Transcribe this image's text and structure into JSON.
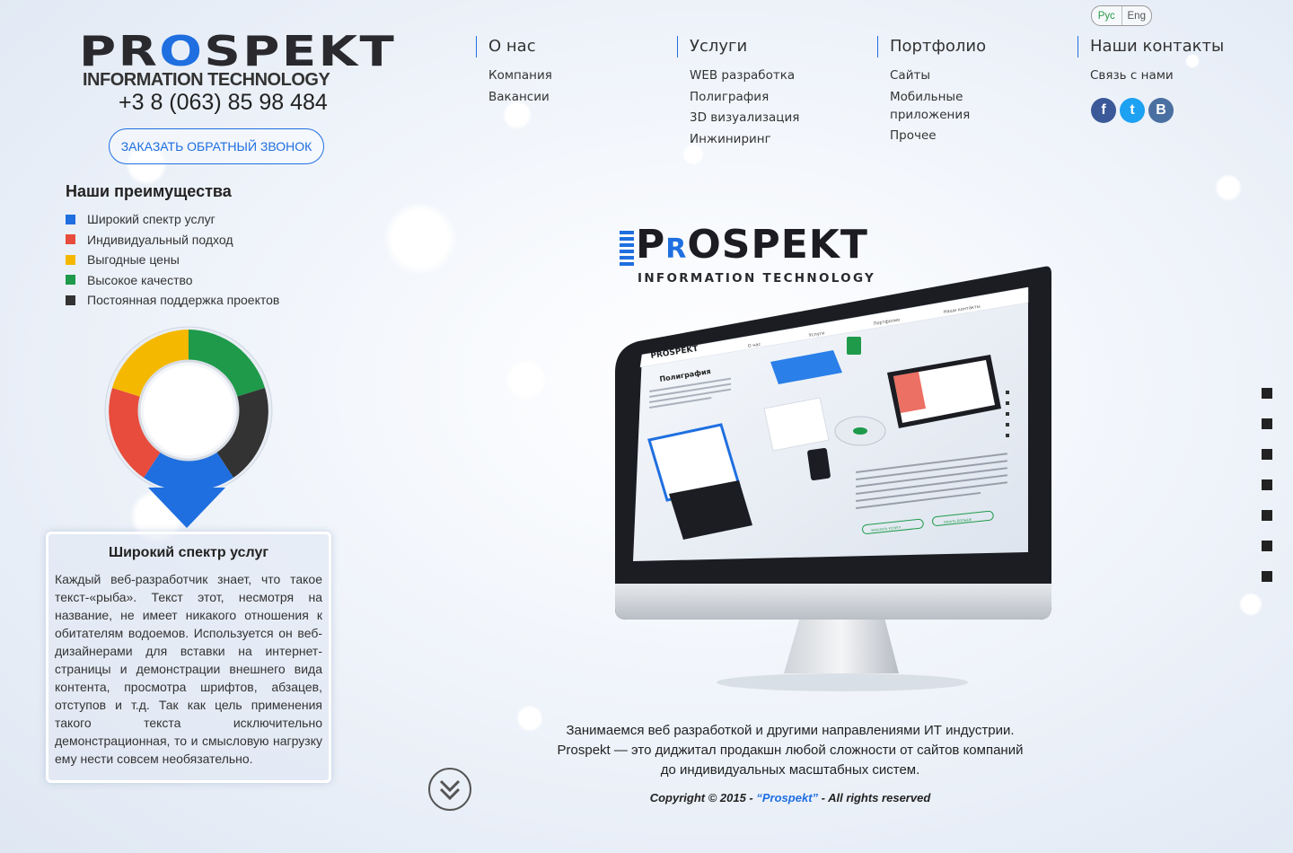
{
  "header": {
    "logo_word_pre": "PR",
    "logo_word_o": "O",
    "logo_word_post": "SPEKT",
    "logo_sub": "INFORMATION TECHNOLOGY",
    "phone": "+3 8 (063) 85 98 484",
    "callback_label": "ЗАКАЗАТЬ ОБРАТНЫЙ ЗВОНОК"
  },
  "language": {
    "ru": "Рус",
    "en": "Eng",
    "active": "ru"
  },
  "nav": [
    {
      "head": "О нас",
      "links": [
        "Компания",
        "Вакансии"
      ]
    },
    {
      "head": "Услуги",
      "links": [
        "WEB разработка",
        "Полиграфия",
        "3D визуализация",
        "Инжиниринг"
      ]
    },
    {
      "head": "Портфолио",
      "links": [
        "Сайты",
        "Мобильные",
        "приложения",
        "Прочее"
      ]
    },
    {
      "head": "Наши контакты",
      "links": [
        "Связь с нами"
      ]
    }
  ],
  "social": [
    {
      "icon": "facebook-icon",
      "glyph": "f",
      "color": "#3b5998"
    },
    {
      "icon": "twitter-icon",
      "glyph": "t",
      "color": "#1da1f2"
    },
    {
      "icon": "vk-icon",
      "glyph": "B",
      "color": "#4a6fa1"
    }
  ],
  "advantages": {
    "title": "Наши преимущества",
    "items": [
      {
        "label": "Широкий спектр услуг",
        "color": "#1f6fe0"
      },
      {
        "label": "Индивидуальный подход",
        "color": "#e74c3c"
      },
      {
        "label": "Выгодные цены",
        "color": "#f5b800"
      },
      {
        "label": "Высокое качество",
        "color": "#1e9a4a"
      },
      {
        "label": "Постоянная поддержка проектов",
        "color": "#333333"
      }
    ],
    "selected_index": 0
  },
  "infobox": {
    "title": "Широкий спектр услуг",
    "text": "Каждый веб-разработчик знает, что такое текст-«рыба». Текст этот, несмотря на название, не имеет никакого отношения к обитателям водоемов. Используется он веб-дизайнерами для вставки на интернет-страницы и демонстрации внешнего вида контента, просмотра шрифтов, абзацев, отступов и т.д. Так как цель применения такого текста исключительно демонстрационная, то и смысловую нагрузку ему нести совсем необязательно."
  },
  "hero": {
    "logo_pre": "P",
    "logo_r": "R",
    "logo_post": "OSPEKT",
    "logo_sub": "INFORMATION TECHNOLOGY",
    "screen_logo": "PROSPEKT",
    "screen_heading": "Полиграфия",
    "screen_menu": [
      "О нас",
      "Услуги",
      "Портфолио",
      "Наши контакты"
    ],
    "screen_buttons": [
      "ЗАКАЗАТЬ УСЛУГУ",
      "УЗНАТЬ БОЛЬШЕ"
    ]
  },
  "footer": {
    "tagline_1": "Занимаемся веб разработкой и другими направлениями ИТ индустрии.",
    "tagline_2": "Prospekt — это диджитал продакшн любой сложности от сайтов компаний",
    "tagline_3": "до индивидуальных масштабных систем.",
    "copyright_pre": "Copyright © 2015 - ",
    "copyright_brand": "“Prospekt”",
    "copyright_post": " - All rights reserved"
  },
  "section_dots_count": 7,
  "colors": {
    "accent": "#1f6fe0",
    "blue": "#1f6fe0",
    "red": "#e74c3c",
    "yellow": "#f5b800",
    "green": "#1e9a4a",
    "dark": "#333333"
  }
}
